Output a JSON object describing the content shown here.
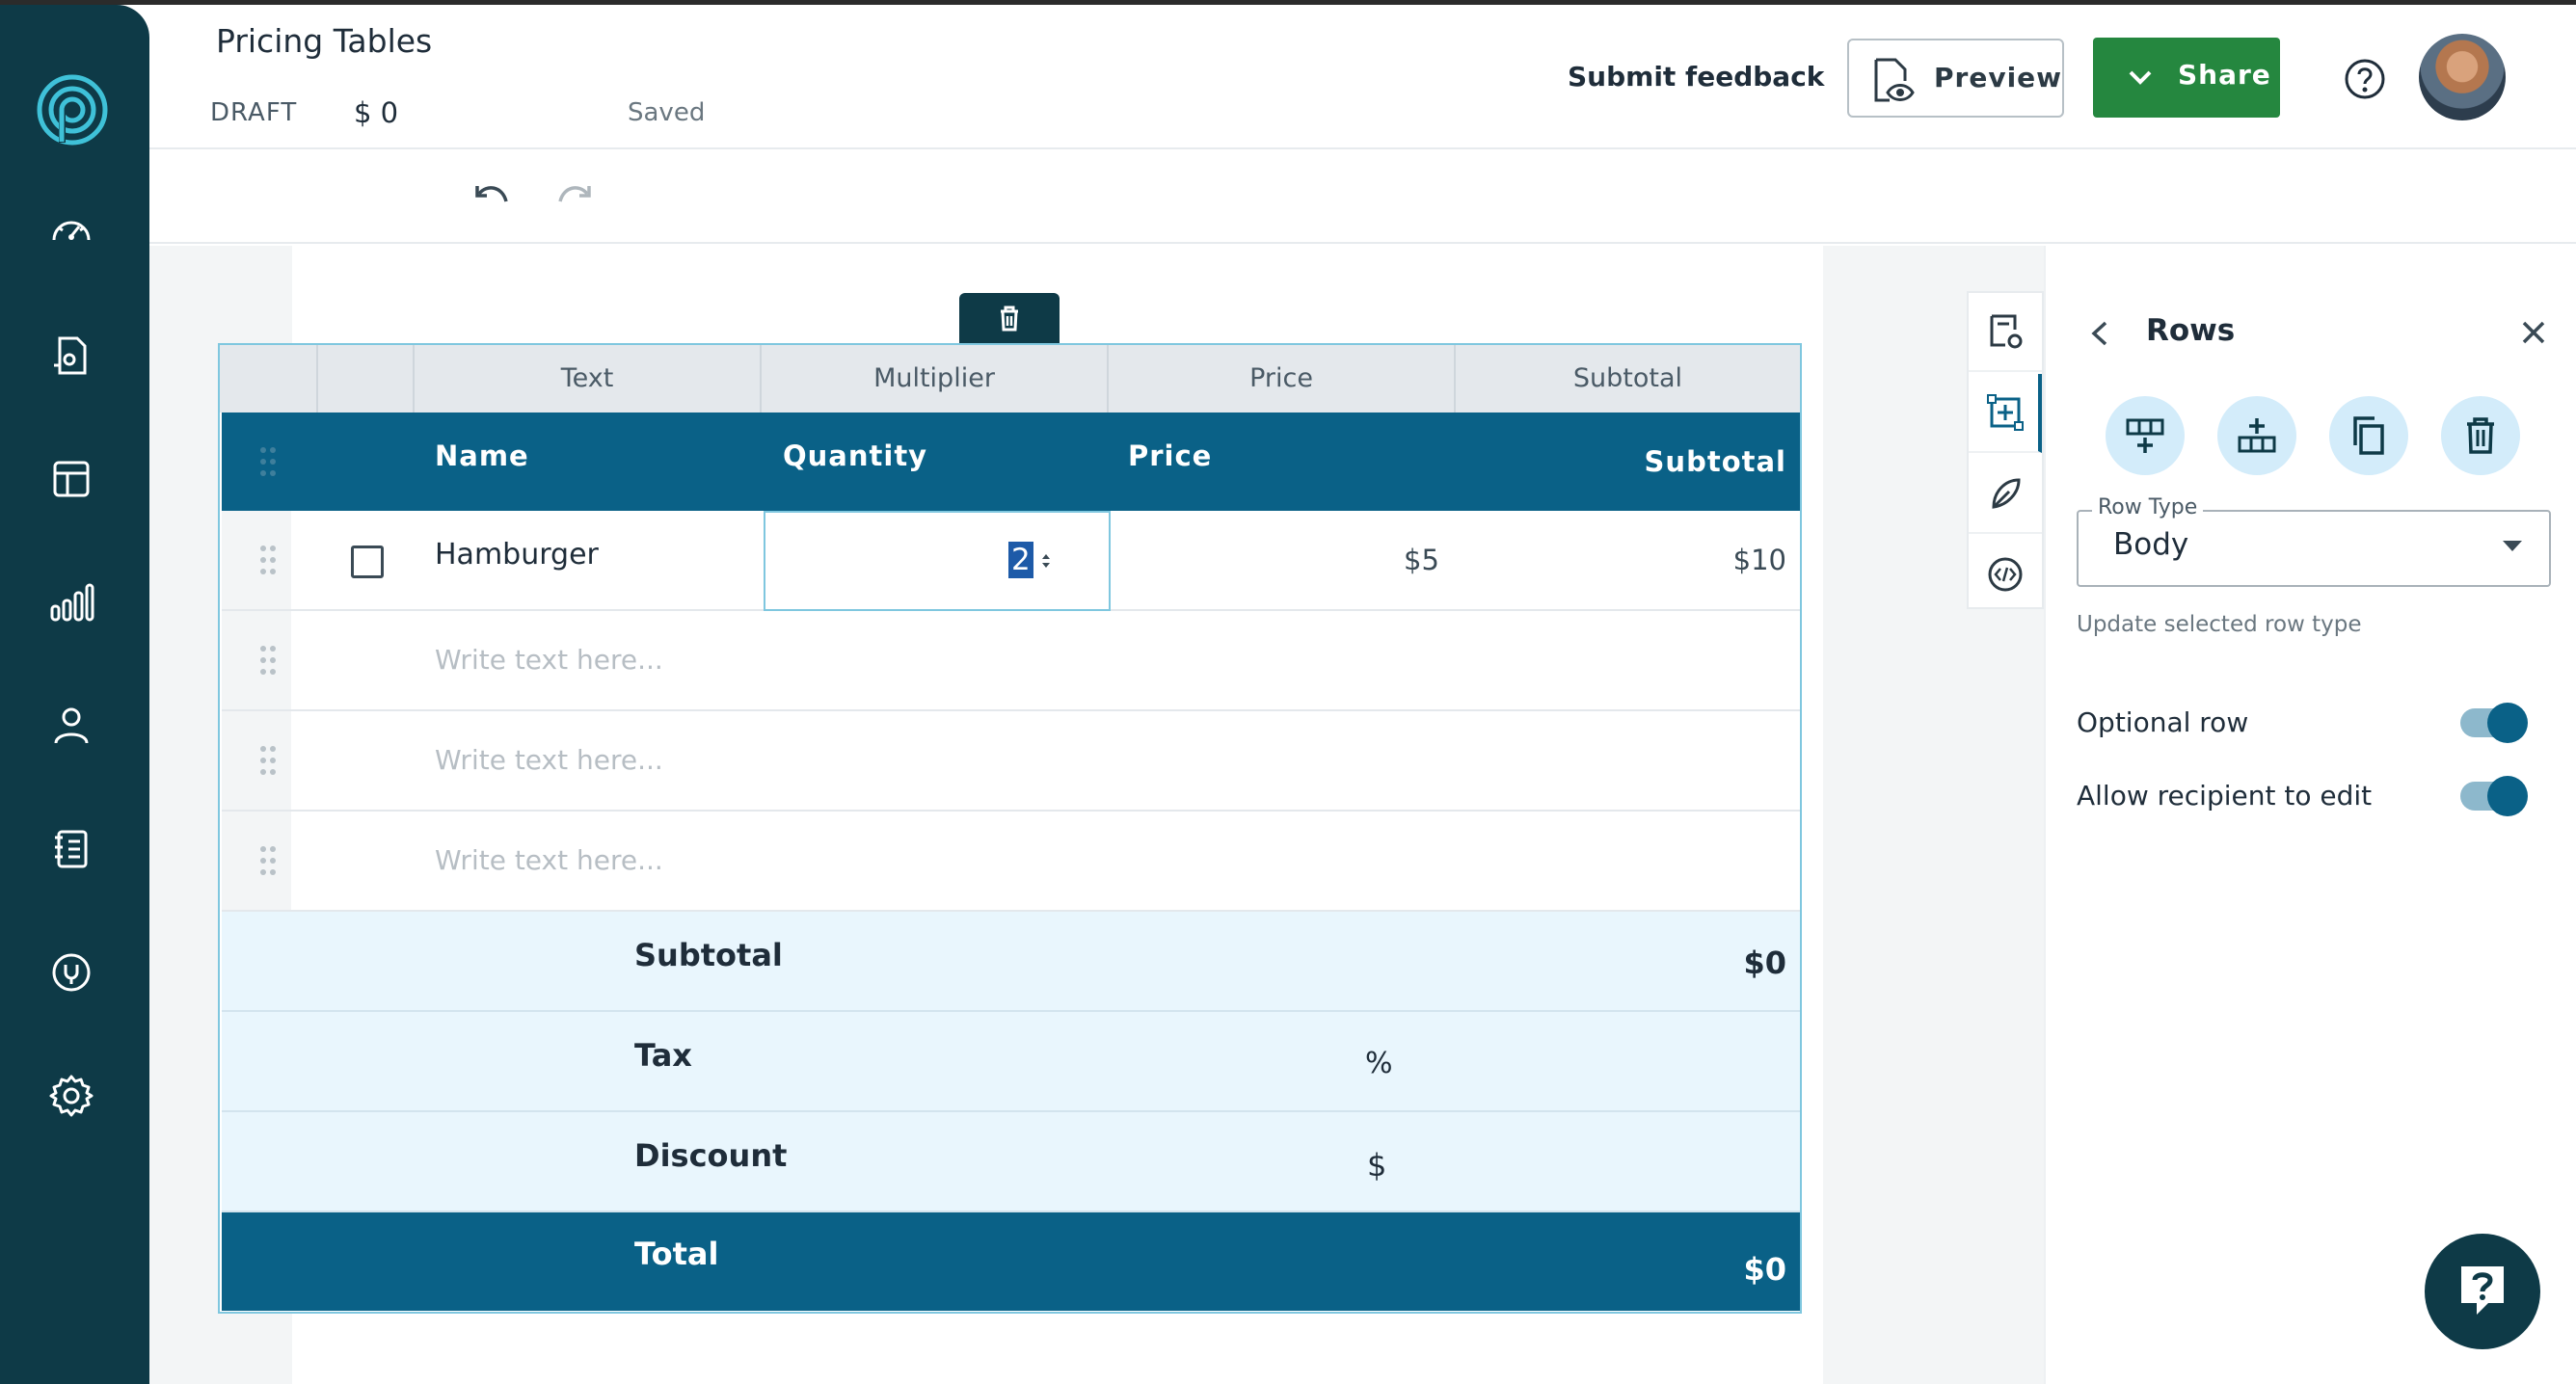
{
  "header": {
    "title": "Pricing Tables",
    "status": "DRAFT",
    "amount": "$  0",
    "saved": "Saved",
    "feedback": "Submit feedback",
    "preview_label": "Preview",
    "share_label": "Share"
  },
  "table": {
    "type_headers": [
      "Text",
      "Multiplier",
      "Price",
      "Subtotal"
    ],
    "headers": {
      "name": "Name",
      "quantity": "Quantity",
      "price": "Price",
      "subtotal": "Subtotal"
    },
    "rows": [
      {
        "name": "Hamburger",
        "quantity": "2",
        "price": "$5",
        "subtotal": "$10"
      }
    ],
    "placeholder": "Write text here...",
    "summary": {
      "subtotal_label": "Subtotal",
      "subtotal_value": "$0",
      "tax_label": "Tax",
      "tax_value": "%",
      "discount_label": "Discount",
      "discount_value": "$",
      "total_label": "Total",
      "total_value": "$0"
    }
  },
  "panel": {
    "title": "Rows",
    "row_type_legend": "Row Type",
    "row_type_value": "Body",
    "hint": "Update selected row type",
    "optional_row": "Optional row",
    "allow_edit": "Allow recipient to edit"
  },
  "colors": {
    "sidebar": "#0e3a47",
    "accent": "#0a6187",
    "share": "#25873f",
    "summary_bg": "#e9f6fd"
  }
}
